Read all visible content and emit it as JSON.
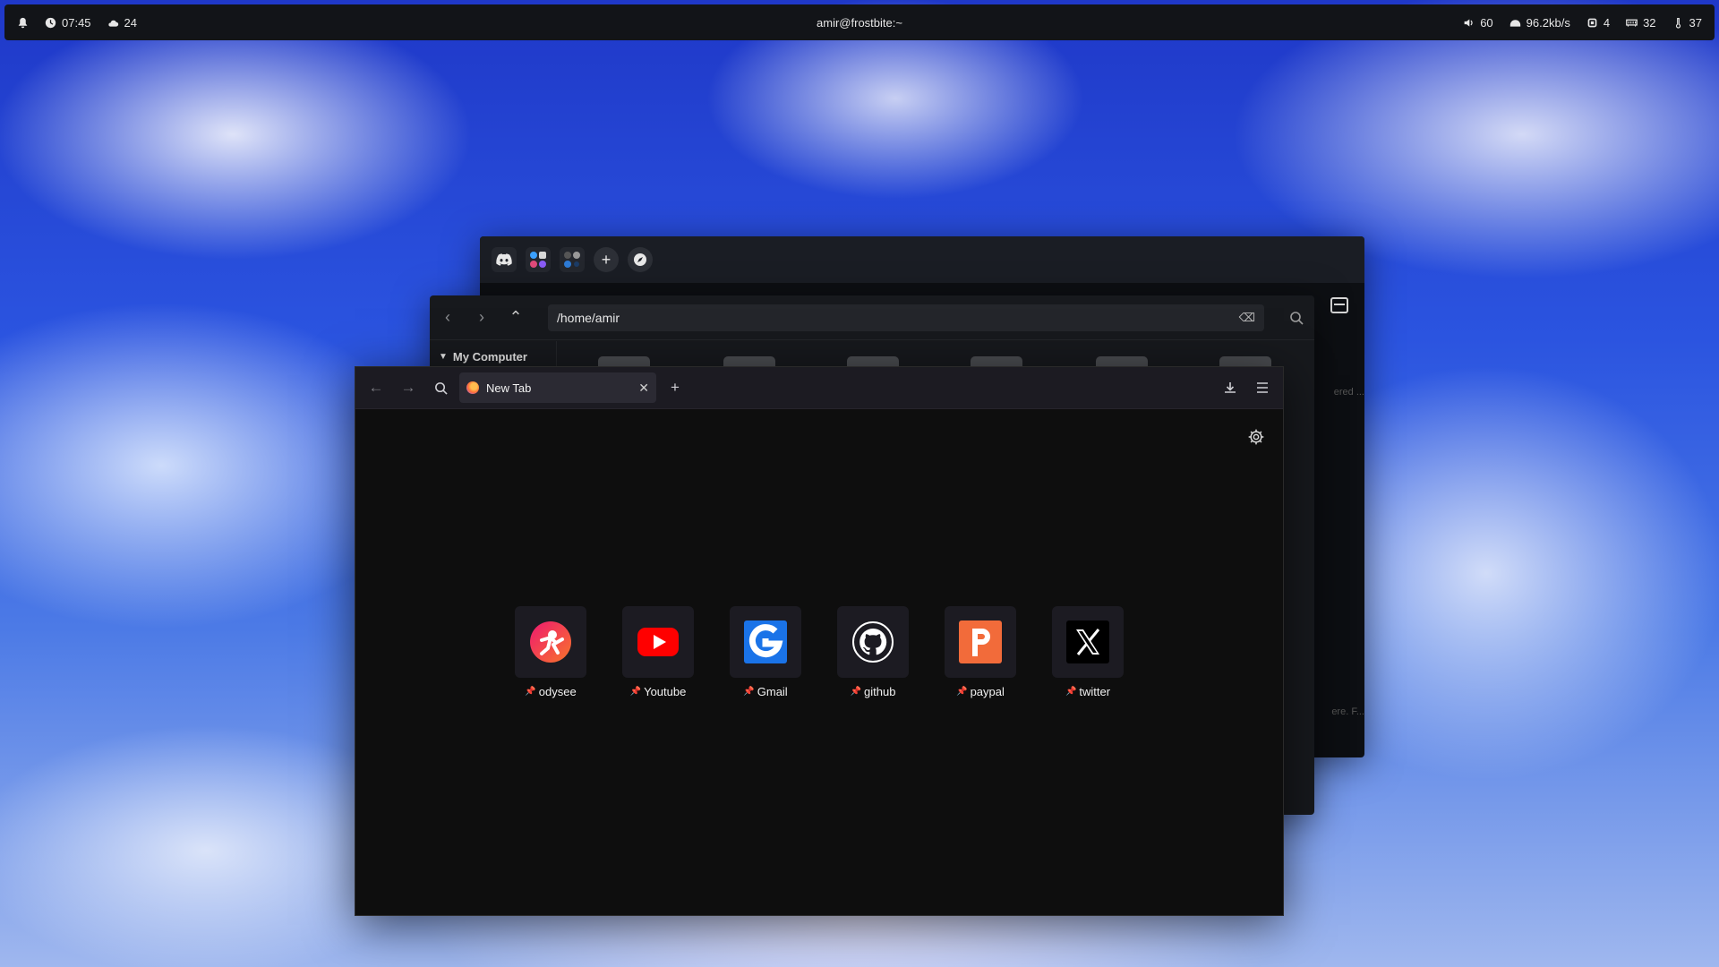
{
  "topbar": {
    "time": "07:45",
    "weather": "24",
    "title": "amir@frostbite:~",
    "volume": "60",
    "network": "96.2kb/s",
    "cpu": "4",
    "memory": "32",
    "temperature": "37",
    "icons": [
      "bell-icon",
      "clock-icon",
      "cloud-icon",
      "volume-icon",
      "network-icon",
      "cpu-icon",
      "memory-icon",
      "thermometer-icon"
    ]
  },
  "file_manager": {
    "path": "/home/amir",
    "sidebar_title": "My Computer",
    "faint_text_1": "ered ...",
    "faint_text_2": "ere. F..."
  },
  "browser": {
    "tab_title": "New Tab",
    "shortcuts": [
      {
        "label": "odysee",
        "icon": "odysee-icon",
        "color": "#ef3d4a"
      },
      {
        "label": "Youtube",
        "icon": "youtube-icon",
        "color": "#ff0000"
      },
      {
        "label": "Gmail",
        "icon": "gmail-icon",
        "color": "#1a73e8"
      },
      {
        "label": "github",
        "icon": "github-icon",
        "color": "#ffffff"
      },
      {
        "label": "paypal",
        "icon": "paypal-icon",
        "color": "#f26b3a"
      },
      {
        "label": "twitter",
        "icon": "x-icon",
        "color": "#000000"
      }
    ]
  },
  "colors": {
    "panel": "#121418",
    "browser_bg": "#0e0e0e",
    "toolbar": "#1c1b22",
    "tab": "#2b2a33"
  }
}
